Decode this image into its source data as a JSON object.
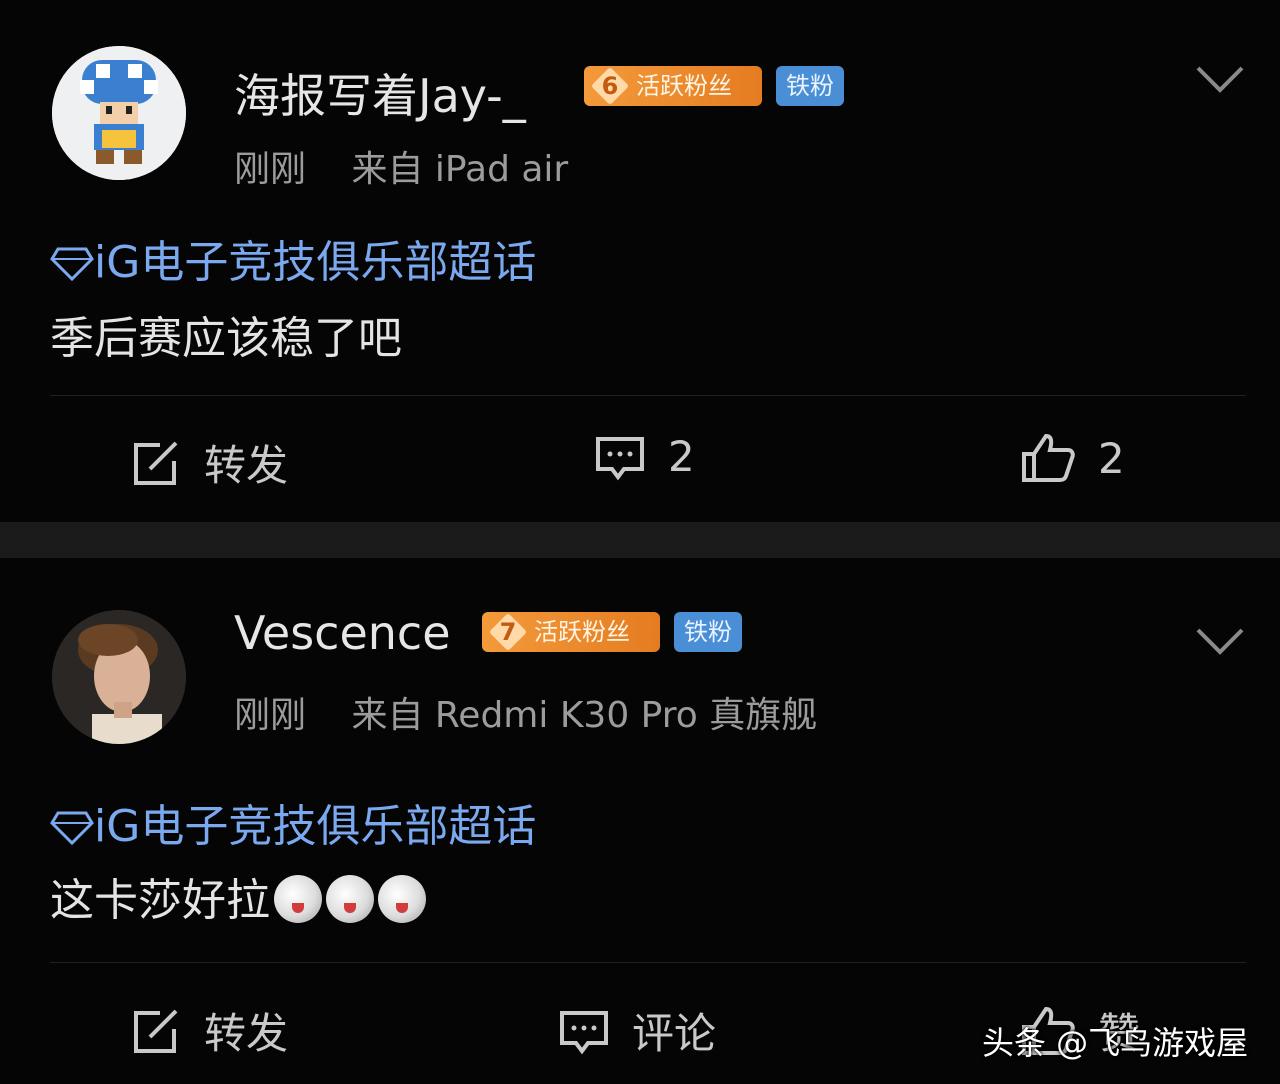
{
  "posts": [
    {
      "username": "海报写着Jay-_",
      "level": "6",
      "active_badge": "活跃粉丝",
      "fan_badge": "铁粉",
      "time": "刚刚",
      "source": "来自 iPad air",
      "topic": "iG电子竞技俱乐部超话",
      "text": "季后赛应该稳了吧",
      "repost_label": "转发",
      "comment_count": "2",
      "like_count": "2"
    },
    {
      "username": "Vescence",
      "level": "7",
      "active_badge": "活跃粉丝",
      "fan_badge": "铁粉",
      "time": "刚刚",
      "source": "来自 Redmi K30 Pro 真旗舰",
      "topic": "iG电子竞技俱乐部超话",
      "text": "这卡莎好拉",
      "repost_label": "转发",
      "comment_label": "评论",
      "like_label": "赞"
    }
  ],
  "watermark": "头条 @飞鸟游戏屋",
  "colors": {
    "background": "#000000",
    "topic_link": "#7aa9f0",
    "active_badge": "#e57c22",
    "fan_badge": "#4a8fd6"
  }
}
